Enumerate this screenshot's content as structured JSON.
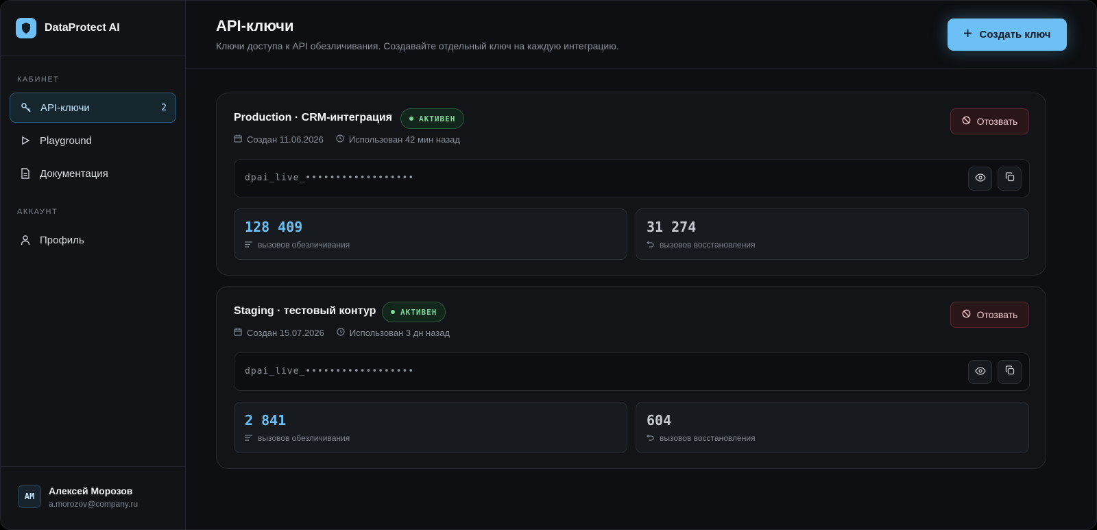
{
  "app": {
    "name": "DataProtect AI"
  },
  "sidebar": {
    "sections": [
      {
        "title": "КАБИНЕТ"
      },
      {
        "title": "АККАУНТ"
      }
    ],
    "items": [
      {
        "label": "API-ключи",
        "count": "2",
        "icon": "key-icon",
        "active": true
      },
      {
        "label": "Playground",
        "icon": "play-icon"
      },
      {
        "label": "Документация",
        "icon": "document-icon"
      },
      {
        "label": "Профиль",
        "icon": "user-icon"
      }
    ],
    "user": {
      "initials": "AM",
      "name": "Алексей Морозов",
      "email": "a.morozov@company.ru"
    }
  },
  "header": {
    "title": "API-ключи",
    "subtitle": "Ключи доступа к API обезличивания. Создавайте отдельный ключ на каждую интеграцию.",
    "create_label": "Создать ключ"
  },
  "keys": [
    {
      "name": "Production · CRM-интеграция",
      "status": "АКТИВЕН",
      "created": "Создан 11.06.2026",
      "used": "Использован 42 мин назад",
      "revoke_label": "Отозвать",
      "key_masked": "dpai_live_••••••••••••••••••",
      "anonymize_count": "128 409",
      "anonymize_label": "вызовов обезличивания",
      "restore_count": "31 274",
      "restore_label": "вызовов восстановления"
    },
    {
      "name": "Staging · тестовый контур",
      "status": "АКТИВЕН",
      "created": "Создан 15.07.2026",
      "used": "Использован 3 дн назад",
      "revoke_label": "Отозвать",
      "key_masked": "dpai_live_••••••••••••••••••",
      "anonymize_count": "2 841",
      "anonymize_label": "вызовов обезличивания",
      "restore_count": "604",
      "restore_label": "вызовов восстановления"
    }
  ],
  "colors": {
    "accent": "#6cc0f5",
    "active_green": "#7fd99a",
    "danger": "#f0c9cd"
  }
}
